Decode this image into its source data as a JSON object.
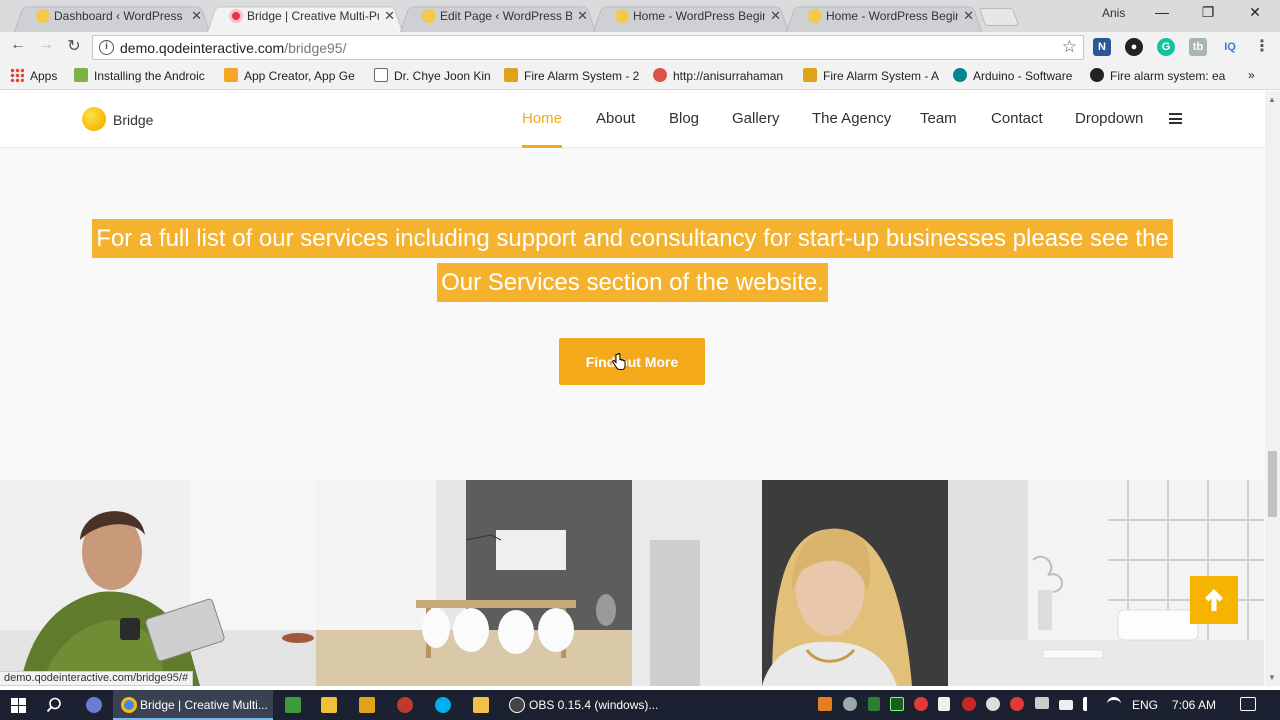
{
  "browser": {
    "tabs": [
      {
        "label": "Dashboard ‹ WordPress Beginner",
        "favicon_color": "#f2c94c",
        "active": false
      },
      {
        "label": "Bridge | Creative Multi-Purpose",
        "favicon_color": "#e8334a",
        "active": true
      },
      {
        "label": "Edit Page ‹ WordPress Beginner",
        "favicon_color": "#f2c94c",
        "active": false
      },
      {
        "label": "Home - WordPress Beginner",
        "favicon_color": "#f2c94c",
        "active": false
      },
      {
        "label": "Home - WordPress Beginner",
        "favicon_color": "#f2c94c",
        "active": false
      }
    ],
    "profile_name": "Anis",
    "window_controls": {
      "minimize": "—",
      "restore": "❐",
      "close": "✕"
    },
    "nav": {
      "back": "←",
      "forward": "→",
      "reload": "↻"
    },
    "url": {
      "host": "demo.qodeinteractive.com",
      "path": "/bridge95/"
    },
    "extensions": [
      {
        "name": "n-extension-icon",
        "glyph": "N",
        "color": "#2b5797"
      },
      {
        "name": "camera-extension-icon",
        "glyph": "●",
        "color": "#222"
      },
      {
        "name": "grammarly-icon",
        "glyph": "G",
        "color": "#15c39a"
      },
      {
        "name": "tb-extension-icon",
        "glyph": "tb",
        "color": "#9aa"
      },
      {
        "name": "iq-extension-icon",
        "glyph": "IQ",
        "color": "#3b7ddd"
      }
    ],
    "menu": "⋮"
  },
  "bookmarks": {
    "apps_label": "Apps",
    "items": [
      {
        "label": "Installing the Androic",
        "color": "#7cb342"
      },
      {
        "label": "App Creator, App Ge",
        "color": "#f5a623"
      },
      {
        "label": "Dr. Chye Joon Kin",
        "color": "#666"
      },
      {
        "label": "Fire Alarm System - 2",
        "color": "#e0a21b"
      },
      {
        "label": "http://anisurrahaman",
        "color": "#d9534f"
      },
      {
        "label": "Fire Alarm System - A",
        "color": "#e0a21b"
      },
      {
        "label": "Arduino - Software",
        "color": "#00878f"
      },
      {
        "label": "Fire alarm system: ea",
        "color": "#222"
      }
    ],
    "overflow": "»"
  },
  "site": {
    "logo": "Bridge",
    "nav": [
      "Home",
      "About",
      "Blog",
      "Gallery",
      "The Agency",
      "Team",
      "Contact",
      "Dropdown"
    ],
    "active_nav": "Home",
    "accent_color": "#f4a91b",
    "headline_line1": "For a full list of our services including support and consultancy for start-up businesses please see the",
    "headline_line2": "Our Services section of the website.",
    "cta_label": "Find out More",
    "back_to_top": "↑"
  },
  "status_bar": {
    "url": "demo.qodeinteractive.com/bridge95/#"
  },
  "taskbar": {
    "apps": [
      {
        "label": "Bridge | Creative Multi...",
        "color": "#4285f4",
        "active": true
      },
      {
        "label": "OBS 0.15.4 (windows)...",
        "color": "#444",
        "active": false
      }
    ],
    "language": "ENG",
    "time": "7:06 AM"
  }
}
